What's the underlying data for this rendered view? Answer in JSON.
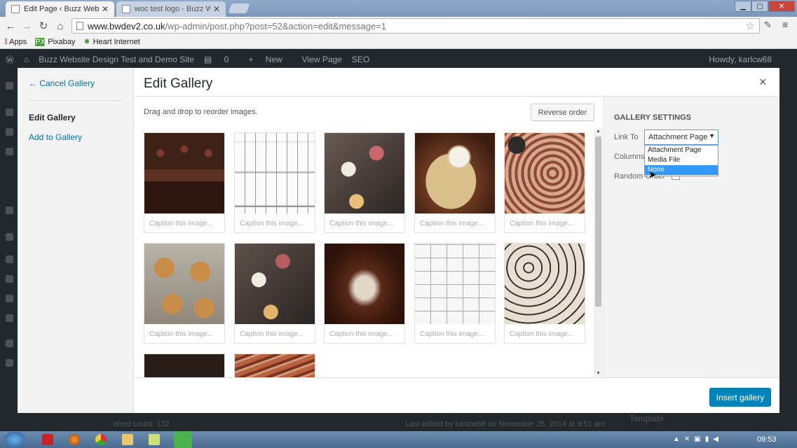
{
  "browser": {
    "tabs": [
      {
        "title": "Edit Page ‹ Buzz Website D",
        "active": true
      },
      {
        "title": "woc test logo - Buzz Websi",
        "active": false
      }
    ],
    "url_host": "www.bwdev2.co.uk",
    "url_path": "/wp-admin/post.php?post=52&action=edit&message=1",
    "bookmarks": [
      {
        "label": "Apps",
        "icon": "apps-grid-icon"
      },
      {
        "label": "Pixabay",
        "icon": "pixabay-icon"
      },
      {
        "label": "Heart Internet",
        "icon": "heart-internet-icon"
      }
    ]
  },
  "adminbar": {
    "site": "Buzz Website Design Test and Demo Site",
    "comments": "0",
    "new": "New",
    "view_page": "View Page",
    "seo": "SEO",
    "howdy": "Howdy, karlcw68"
  },
  "menu": {
    "cancel": "← Cancel Gallery",
    "edit": "Edit Gallery",
    "add": "Add to Gallery"
  },
  "gallery": {
    "title": "Edit Gallery",
    "close": "×",
    "instructions": "Drag and drop to reorder images.",
    "reverse_label": "Reverse order",
    "caption_placeholder": "Caption this image...",
    "images": [
      {
        "name": "chocolate-cake"
      },
      {
        "name": "house-elevation-drawing"
      },
      {
        "name": "cake-stand-treats"
      },
      {
        "name": "pudding-with-cream"
      },
      {
        "name": "chocolate-tray-bake"
      },
      {
        "name": "scones-on-tray"
      },
      {
        "name": "cake-stand-treats-2"
      },
      {
        "name": "chocolate-pudding-bowl"
      },
      {
        "name": "floor-plan-drawing"
      },
      {
        "name": "cookie-bars"
      },
      {
        "name": "dessert-bowls"
      },
      {
        "name": "bacon-slices"
      }
    ],
    "insert_label": "Insert gallery"
  },
  "settings": {
    "title": "GALLERY SETTINGS",
    "link_to_label": "Link To",
    "link_to_value": "Attachment Page",
    "options": [
      "Attachment Page",
      "Media File",
      "None"
    ],
    "highlighted_option": "None",
    "columns_label": "Columns",
    "random_label": "Random Order"
  },
  "wp_footer": {
    "word_count": "Word count: 132",
    "last_edited": "Last edited by karlcw68 on November 25, 2014 at 9:51 am",
    "template": "Template"
  },
  "taskbar": {
    "time": "09:53"
  },
  "colors": {
    "primary": "#0085ba",
    "link": "#0073aa",
    "highlight": "#3399ff",
    "adminbar": "#23282d"
  }
}
